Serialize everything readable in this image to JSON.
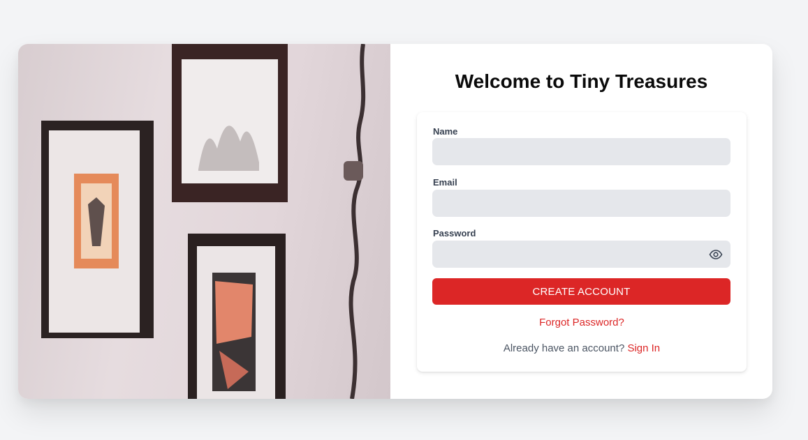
{
  "header": {
    "title": "Welcome to Tiny Treasures"
  },
  "form": {
    "name_label": "Name",
    "name_value": "",
    "email_label": "Email",
    "email_value": "",
    "password_label": "Password",
    "password_value": "",
    "submit_label": "CREATE ACCOUNT",
    "forgot_label": "Forgot Password?",
    "signin_prompt": "Already have an account?",
    "signin_label": "Sign In"
  },
  "icons": {
    "password_toggle": "eye-icon"
  },
  "colors": {
    "accent": "#dc2626",
    "input_bg": "#e5e7eb",
    "page_bg": "#f3f4f6"
  }
}
